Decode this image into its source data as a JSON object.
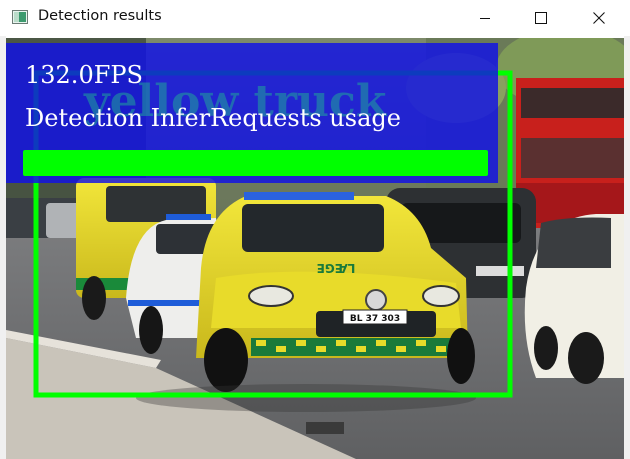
{
  "window": {
    "title": "Detection results",
    "icon": "app-window-icon",
    "controls": [
      "minimize-icon",
      "maximize-icon",
      "close-icon"
    ]
  },
  "overlay": {
    "fps_text": "132.0FPS",
    "usage_text": "Detection InferRequests usage",
    "usage_fraction": 1.0,
    "panel_color": "#1010e8",
    "bar_color": "#00ff00"
  },
  "detection": {
    "label": "yellow truck",
    "box_color": "#00ff00"
  },
  "scene": {
    "license_plate": "BL 37 303",
    "hood_text": "LÆGE"
  }
}
